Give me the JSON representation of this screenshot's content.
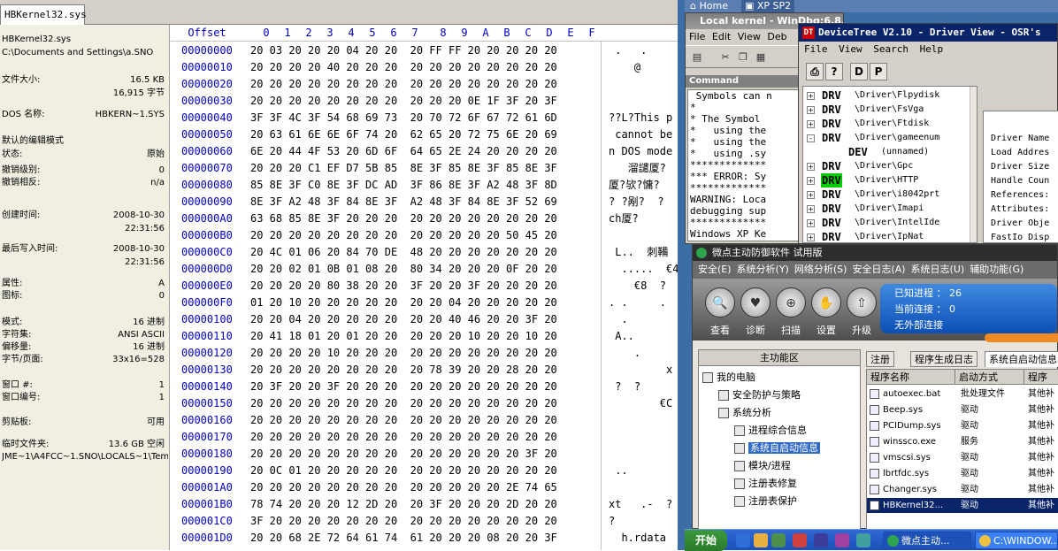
{
  "hex_editor": {
    "tab_label": "HBKernel32.sys",
    "info": {
      "file_name": "HBKernel32.sys",
      "path": "C:\\Documents and Settings\\a.SNO",
      "rows": [
        {
          "k": "文件大小:",
          "v": "16.5 KB"
        },
        {
          "k": "",
          "v": "16,915 字节"
        },
        {
          "k": "DOS 名称:",
          "v": "HBKERN~1.SYS"
        },
        {
          "k": "默认的编辑模式",
          "v": ""
        },
        {
          "k": "状态:",
          "v": "原始"
        },
        {
          "k": "撤销级别:",
          "v": "0"
        },
        {
          "k": "撤销相反:",
          "v": "n/a"
        },
        {
          "k": "创建时间:",
          "v": "2008-10-30"
        },
        {
          "k": "",
          "v": "22:31:56"
        },
        {
          "k": "最后写入时间:",
          "v": "2008-10-30"
        },
        {
          "k": "",
          "v": "22:31:56"
        },
        {
          "k": "属性:",
          "v": "A"
        },
        {
          "k": "图标:",
          "v": "0"
        },
        {
          "k": "模式:",
          "v": "16 进制"
        },
        {
          "k": "字符集:",
          "v": "ANSI ASCII"
        },
        {
          "k": "偏移量:",
          "v": "16 进制"
        },
        {
          "k": "字节/页面:",
          "v": "33x16=528"
        },
        {
          "k": "窗口 #:",
          "v": "1"
        },
        {
          "k": "窗口编号:",
          "v": "1"
        },
        {
          "k": "剪贴板:",
          "v": "可用"
        },
        {
          "k": "临时文件夹:",
          "v": "13.6 GB 空闲"
        },
        {
          "k": "",
          "v": "JME~1\\A4FCC~1.SNO\\LOCALS~1\\Temp"
        }
      ]
    },
    "offset_header": "Offset",
    "col_headers": [
      "0",
      "1",
      "2",
      "3",
      "4",
      "5",
      "6",
      "7",
      "8",
      "9",
      "A",
      "B",
      "C",
      "D",
      "E",
      "F"
    ],
    "rows": [
      {
        "off": "00000000",
        "bytes": "20 03 20 20 20 04 20 20  20 FF FF 20 20 20 20 20",
        "text": " .   .     "
      },
      {
        "off": "00000010",
        "bytes": "20 20 20 20 40 20 20 20  20 20 20 20 20 20 20 20",
        "text": "    @"
      },
      {
        "off": "00000020",
        "bytes": "20 20 20 20 20 20 20 20  20 20 20 20 20 20 20 20",
        "text": ""
      },
      {
        "off": "00000030",
        "bytes": "20 20 20 20 20 20 20 20  20 20 20 0E 1F 3F 20 3F",
        "text": ""
      },
      {
        "off": "00000040",
        "bytes": "3F 3F 4C 3F 54 68 69 73  20 70 72 6F 67 72 61 6D",
        "text": "??L?This p"
      },
      {
        "off": "00000050",
        "bytes": "20 63 61 6E 6E 6F 74 20  62 65 20 72 75 6E 20 69",
        "text": " cannot be"
      },
      {
        "off": "00000060",
        "bytes": "6E 20 44 4F 53 20 6D 6F  64 65 2E 24 20 20 20 20",
        "text": "n DOS mode"
      },
      {
        "off": "00000070",
        "bytes": "20 20 20 C1 EF D7 5B 85  8E 3F 85 8E 3F 85 8E 3F",
        "text": "   溜譴厦?"
      },
      {
        "off": "00000080",
        "bytes": "85 8E 3F C0 8E 3F DC AD  3F 86 8E 3F A2 48 3F 8D",
        "text": "厦?欤?慵?"
      },
      {
        "off": "00000090",
        "bytes": "8E 3F A2 48 3F 84 8E 3F  A2 48 3F 84 8E 3F 52 69",
        "text": "? ?剐?  ?"
      },
      {
        "off": "000000A0",
        "bytes": "63 68 85 8E 3F 20 20 20  20 20 20 20 20 20 20 20",
        "text": "ch厦?"
      },
      {
        "off": "000000B0",
        "bytes": "20 20 20 20 20 20 20 20  20 20 20 20 20 50 45 20",
        "text": ""
      },
      {
        "off": "000000C0",
        "bytes": "20 4C 01 06 20 84 70 DE  48 20 20 20 20 20 20 20",
        "text": " L..  刺鞴"
      },
      {
        "off": "000000D0",
        "bytes": "20 20 02 01 0B 01 08 20  80 34 20 20 20 0F 20 20",
        "text": "  .....  €4"
      },
      {
        "off": "000000E0",
        "bytes": "20 20 20 20 80 38 20 20  3F 20 20 3F 20 20 20 20",
        "text": "    €8  ?"
      },
      {
        "off": "000000F0",
        "bytes": "01 20 10 20 20 20 20 20  20 20 04 20 20 20 20 20",
        "text": ". .     ."
      },
      {
        "off": "00000100",
        "bytes": "20 20 04 20 20 20 20 20  20 20 40 46 20 20 3F 20",
        "text": "  ."
      },
      {
        "off": "00000110",
        "bytes": "20 41 18 01 20 01 20 20  20 20 20 10 20 20 10 20",
        "text": " A.."
      },
      {
        "off": "00000120",
        "bytes": "20 20 20 20 10 20 20 20  20 20 20 20 20 20 20 20",
        "text": "    ."
      },
      {
        "off": "00000130",
        "bytes": "20 20 20 20 20 20 20 20  20 78 39 20 20 28 20 20",
        "text": "         x"
      },
      {
        "off": "00000140",
        "bytes": "20 3F 20 20 3F 20 20 20  20 20 20 20 20 20 20 20",
        "text": " ?  ?"
      },
      {
        "off": "00000150",
        "bytes": "20 20 20 20 20 20 20 20  20 20 20 20 20 20 20 20",
        "text": "        €C"
      },
      {
        "off": "00000160",
        "bytes": "20 20 20 20 20 20 20 20  20 20 20 20 20 20 20 20",
        "text": ""
      },
      {
        "off": "00000170",
        "bytes": "20 20 20 20 20 20 20 20  20 20 20 20 20 20 20 20",
        "text": ""
      },
      {
        "off": "00000180",
        "bytes": "20 20 20 20 20 20 20 20  20 20 20 20 20 20 3F 20",
        "text": ""
      },
      {
        "off": "00000190",
        "bytes": "20 0C 01 20 20 20 20 20  20 20 20 20 20 20 20 20",
        "text": " .."
      },
      {
        "off": "000001A0",
        "bytes": "20 20 20 20 20 20 20 20  20 20 20 20 20 2E 74 65",
        "text": ""
      },
      {
        "off": "000001B0",
        "bytes": "78 74 20 20 20 12 2D 20  20 3F 20 20 20 2D 20 20",
        "text": "xt   .-  ?"
      },
      {
        "off": "000001C0",
        "bytes": "3F 20 20 20 20 20 20 20  20 20 20 20 20 20 20 20",
        "text": "?"
      },
      {
        "off": "000001D0",
        "bytes": "20 20 68 2E 72 64 61 74  61 20 20 20 08 20 20 3F",
        "text": "  h.rdata"
      }
    ]
  },
  "vm_tabs": [
    "Home",
    "XP SP2"
  ],
  "windbg": {
    "title": "Local kernel - WinDbg:6.8.0004.0",
    "menu": [
      "File",
      "Edit",
      "View",
      "Deb"
    ],
    "command_header": "Command",
    "log": " Symbols can n\n*\n* The Symbol\n*   using the\n*   using the\n*   using .sy\n*************\n*** ERROR: Sy\n*************\nWARNING: Loca\ndebugging sup\n*************\nWindows XP Ke\nProduct: WinN"
  },
  "devicetree": {
    "title": "DeviceTree V2.10 - Driver View - OSR's",
    "icon": "DT",
    "menu": [
      "File",
      "View",
      "Search",
      "Help"
    ],
    "tool_labels": [
      "D",
      "P"
    ],
    "tree": [
      {
        "pm": "+",
        "lbl": "DRV",
        "path": "\\Driver\\Flpydisk",
        "hl": false,
        "indent": 0
      },
      {
        "pm": "+",
        "lbl": "DRV",
        "path": "\\Driver\\FsVga",
        "hl": false,
        "indent": 0
      },
      {
        "pm": "+",
        "lbl": "DRV",
        "path": "\\Driver\\Ftdisk",
        "hl": false,
        "indent": 0
      },
      {
        "pm": "-",
        "lbl": "DRV",
        "path": "\\Driver\\gameenum",
        "hl": false,
        "indent": 0
      },
      {
        "pm": "",
        "lbl": "DEV",
        "path": "(unnamed)",
        "hl": false,
        "indent": 1
      },
      {
        "pm": "+",
        "lbl": "DRV",
        "path": "\\Driver\\Gpc",
        "hl": false,
        "indent": 0
      },
      {
        "pm": "+",
        "lbl": "DRV",
        "path": "\\Driver\\HTTP",
        "hl": true,
        "indent": 0
      },
      {
        "pm": "+",
        "lbl": "DRV",
        "path": "\\Driver\\i8042prt",
        "hl": false,
        "indent": 0
      },
      {
        "pm": "+",
        "lbl": "DRV",
        "path": "\\Driver\\Imapi",
        "hl": false,
        "indent": 0
      },
      {
        "pm": "+",
        "lbl": "DRV",
        "path": "\\Driver\\IntelIde",
        "hl": false,
        "indent": 0
      },
      {
        "pm": "+",
        "lbl": "DRV",
        "path": "\\Driver\\IpNat",
        "hl": false,
        "indent": 0
      }
    ],
    "info_labels": [
      "Driver Name",
      "Load Addres",
      "Driver Size",
      "Handle Coun",
      "References:",
      "Attributes:",
      "Driver Obje",
      "FastIo Disp",
      "StartIo Ent"
    ]
  },
  "firewall": {
    "title": "微点主动防御软件    试用版",
    "menu": [
      "安全(E)",
      "系统分析(Y)",
      "网络分析(S)",
      "安全日志(A)",
      "系统日志(U)",
      "辅助功能(G)"
    ],
    "buttons": [
      {
        "icon": "search-icon",
        "glyph": "🔍",
        "label": "查看"
      },
      {
        "icon": "heart-icon",
        "glyph": "♥",
        "label": "诊断"
      },
      {
        "icon": "scan-icon",
        "glyph": "⊕",
        "label": "扫描"
      },
      {
        "icon": "hand-icon",
        "glyph": "✋",
        "label": "设置"
      },
      {
        "icon": "upgrade-icon",
        "glyph": "⇧",
        "label": "升级"
      }
    ],
    "stats": [
      {
        "label": "已知进程",
        "value": "26"
      },
      {
        "label": "当前连接",
        "value": "0"
      },
      {
        "label": "无外部连接",
        "value": ""
      }
    ],
    "left_header": "主功能区",
    "tree": [
      {
        "label": "我的电脑",
        "indent": 0,
        "sel": false
      },
      {
        "label": "安全防护与策略",
        "indent": 1,
        "sel": false
      },
      {
        "label": "系统分析",
        "indent": 1,
        "sel": false
      },
      {
        "label": "进程综合信息",
        "indent": 2,
        "sel": false
      },
      {
        "label": "系统自启动信息",
        "indent": 2,
        "sel": true
      },
      {
        "label": "模块/进程",
        "indent": 2,
        "sel": false
      },
      {
        "label": "注册表修复",
        "indent": 2,
        "sel": false
      },
      {
        "label": "注册表保护",
        "indent": 2,
        "sel": false
      }
    ],
    "tabs": [
      "注册",
      "程序生成日志",
      "系统自启动信息"
    ],
    "columns": [
      "程序名称",
      "启动方式",
      "程序"
    ],
    "rows": [
      {
        "name": "autoexec.bat",
        "mode": "批处理文件",
        "extra": "其他补",
        "sel": false
      },
      {
        "name": "Beep.sys",
        "mode": "驱动",
        "extra": "其他补",
        "sel": false
      },
      {
        "name": "PCIDump.sys",
        "mode": "驱动",
        "extra": "其他补",
        "sel": false
      },
      {
        "name": "winssco.exe",
        "mode": "服务",
        "extra": "其他补",
        "sel": false
      },
      {
        "name": "vmscsi.sys",
        "mode": "驱动",
        "extra": "其他补",
        "sel": false
      },
      {
        "name": "lbrtfdc.sys",
        "mode": "驱动",
        "extra": "其他补",
        "sel": false
      },
      {
        "name": "Changer.sys",
        "mode": "驱动",
        "extra": "其他补",
        "sel": false
      },
      {
        "name": "HBKernel32...",
        "mode": "驱动",
        "extra": "其他补",
        "sel": true
      }
    ]
  },
  "taskbar": {
    "start": "开始",
    "tasks": [
      {
        "label": "微点主动...",
        "active": true,
        "color": "#2ea44f"
      },
      {
        "label": "C:\\WINDOW...",
        "active": false,
        "color": "#f0c040"
      }
    ]
  }
}
